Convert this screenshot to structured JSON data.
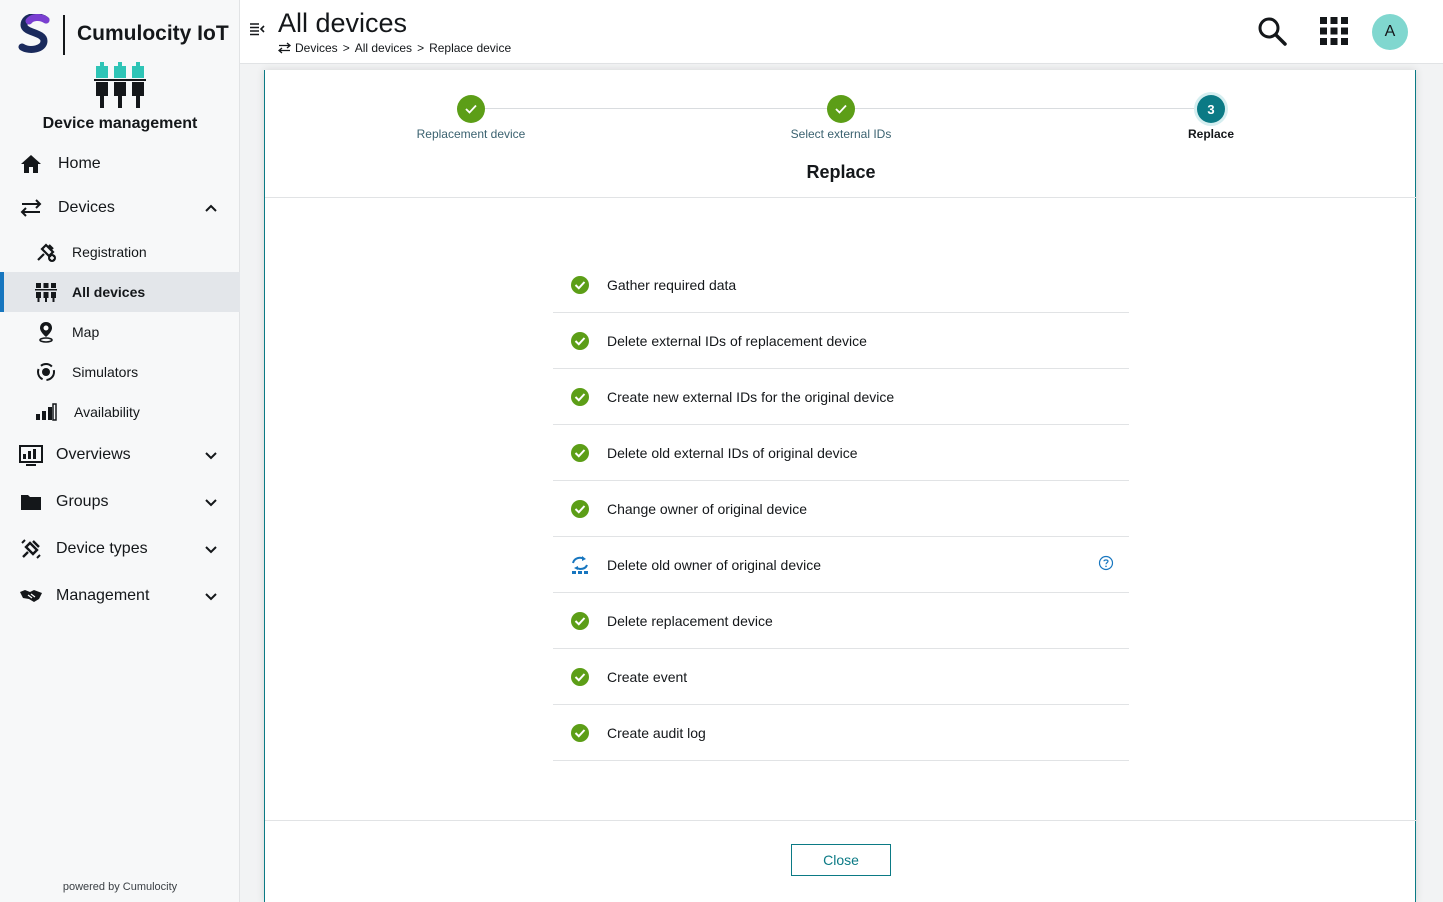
{
  "brand": {
    "name": "Cumulocity IoT",
    "logo_icon": "cumulocity-logo",
    "accent": "#1776bf"
  },
  "app": {
    "name": "Device management",
    "icon": "device-management-icon"
  },
  "sidebar": {
    "items": [
      {
        "label": "Home",
        "icon": "home-icon"
      },
      {
        "label": "Devices",
        "icon": "devices-icon",
        "expanded": true
      },
      {
        "label": "Registration",
        "icon": "registration-icon"
      },
      {
        "label": "All devices",
        "icon": "all-devices-icon",
        "active": true
      },
      {
        "label": "Map",
        "icon": "map-pin-icon"
      },
      {
        "label": "Simulators",
        "icon": "simulators-icon"
      },
      {
        "label": "Availability",
        "icon": "availability-icon"
      },
      {
        "label": "Overviews",
        "icon": "overviews-icon"
      },
      {
        "label": "Groups",
        "icon": "folder-icon"
      },
      {
        "label": "Device types",
        "icon": "device-types-icon"
      },
      {
        "label": "Management",
        "icon": "handshake-icon"
      }
    ],
    "powered_by": "powered by Cumulocity"
  },
  "header": {
    "title": "All devices",
    "breadcrumb": [
      "Devices",
      "All devices",
      "Replace device"
    ],
    "breadcrumb_separator": ">",
    "avatar_initial": "A"
  },
  "wizard": {
    "steps": [
      {
        "number": "1",
        "label": "Replacement device",
        "state": "done"
      },
      {
        "number": "2",
        "label": "Select external IDs",
        "state": "done"
      },
      {
        "number": "3",
        "label": "Replace",
        "state": "current"
      }
    ],
    "title": "Replace",
    "tasks": [
      {
        "label": "Gather required data",
        "status": "done"
      },
      {
        "label": "Delete external IDs of replacement device",
        "status": "done"
      },
      {
        "label": "Create new external IDs for the original device",
        "status": "done"
      },
      {
        "label": "Delete old external IDs of original device",
        "status": "done"
      },
      {
        "label": "Change owner of original device",
        "status": "done"
      },
      {
        "label": "Delete old owner of original device",
        "status": "skipped",
        "has_help": true
      },
      {
        "label": "Delete replacement device",
        "status": "done"
      },
      {
        "label": "Create event",
        "status": "done"
      },
      {
        "label": "Create audit log",
        "status": "done"
      }
    ],
    "close_label": "Close",
    "colors": {
      "done": "#5c9e17",
      "current": "#0b7a85"
    }
  }
}
